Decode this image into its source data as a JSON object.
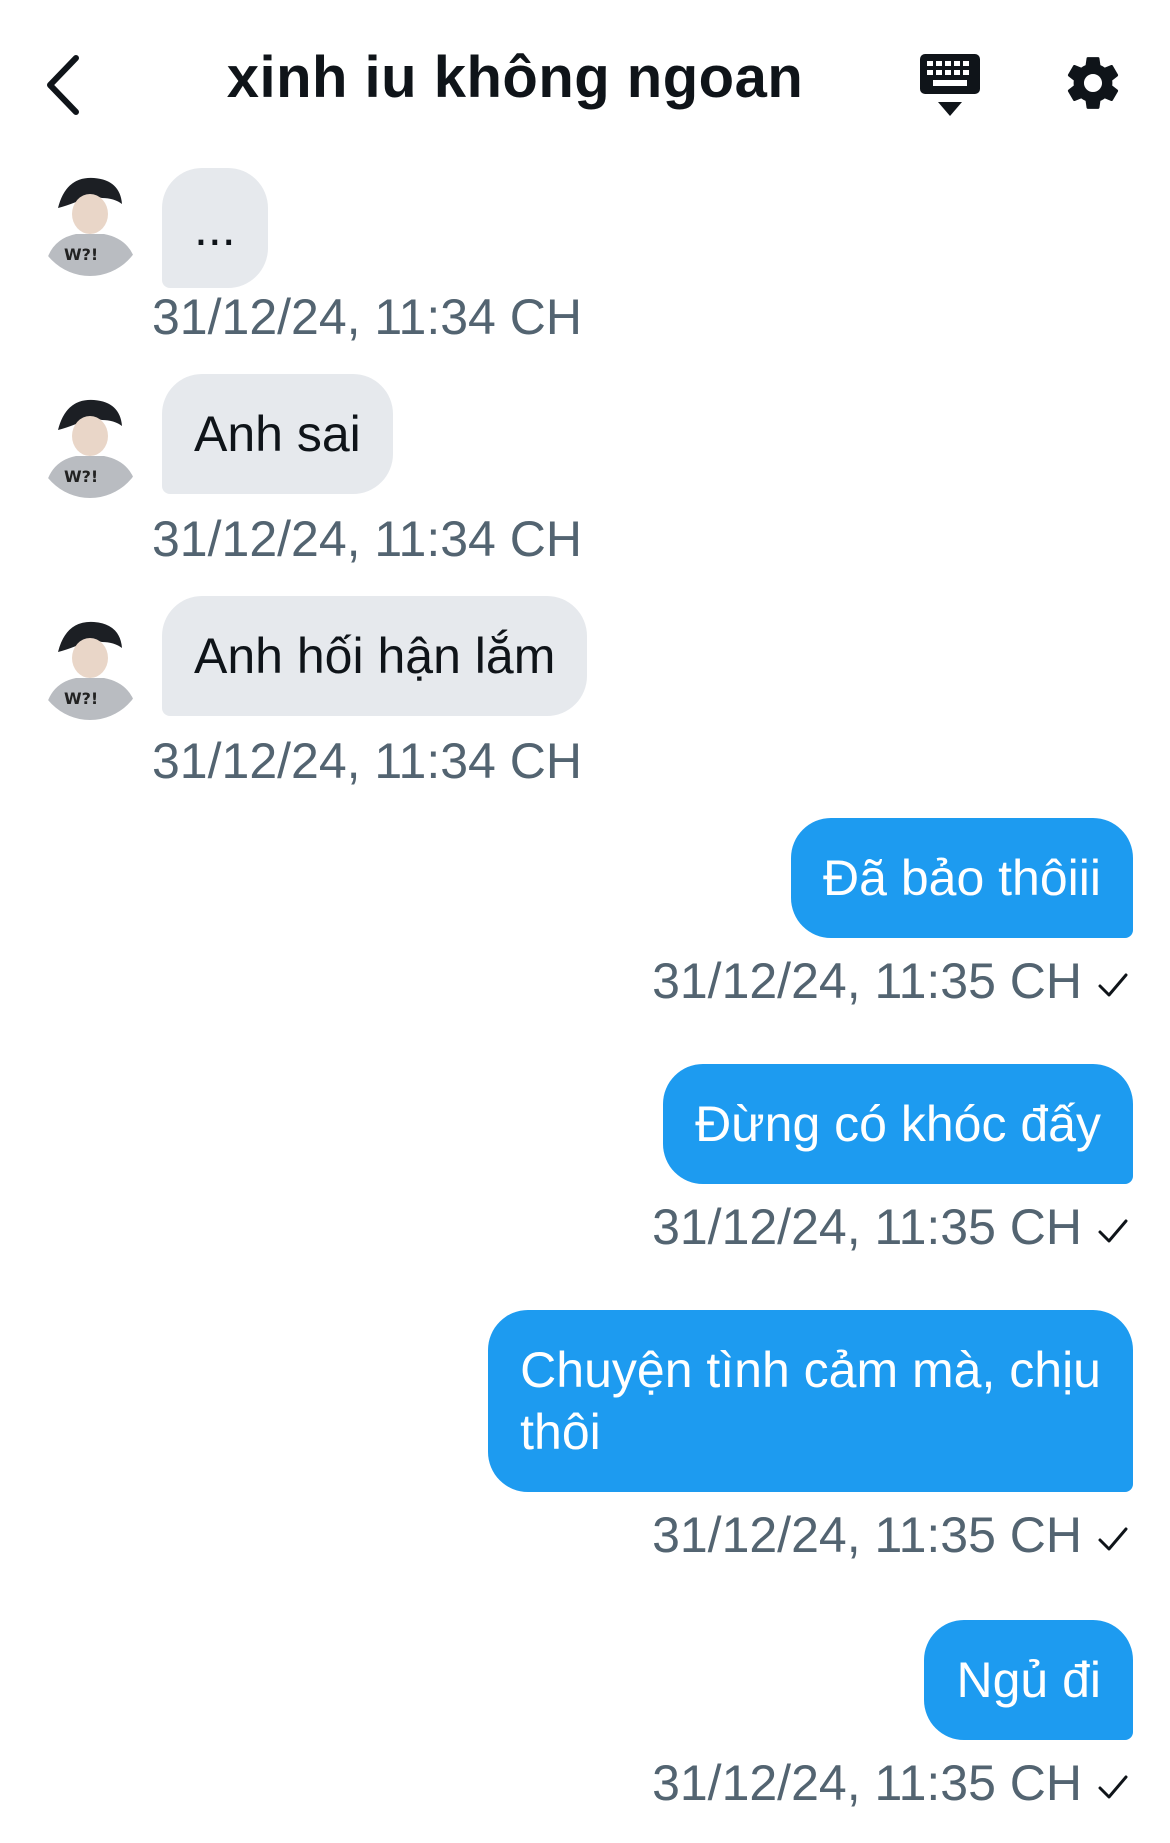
{
  "header": {
    "title": "xinh iu không ngoan",
    "back_icon": "chevron-left-icon",
    "keyboard_icon": "keyboard-icon",
    "settings_icon": "gear-icon"
  },
  "colors": {
    "incoming_bubble": "#e6e9ed",
    "outgoing_bubble": "#1d9bf0",
    "timestamp": "#536471",
    "text": "#0f1419"
  },
  "messages": [
    {
      "direction": "incoming",
      "text": "...",
      "time": "31/12/24, 11:34 CH"
    },
    {
      "direction": "incoming",
      "text": "Anh sai",
      "time": "31/12/24, 11:34 CH"
    },
    {
      "direction": "incoming",
      "text": "Anh hối hận lắm",
      "time": "31/12/24, 11:34 CH"
    },
    {
      "direction": "outgoing",
      "text": "Đã bảo thôiii",
      "time": "31/12/24, 11:35 CH",
      "status_icon": "checkmark-icon"
    },
    {
      "direction": "outgoing",
      "text": "Đừng có khóc đấy",
      "time": "31/12/24, 11:35 CH",
      "status_icon": "checkmark-icon"
    },
    {
      "direction": "outgoing",
      "text": "Chuyện tình cảm mà, chịu\nthôi",
      "time": "31/12/24, 11:35 CH",
      "status_icon": "checkmark-icon"
    },
    {
      "direction": "outgoing",
      "text": "Ngủ đi",
      "time": "31/12/24, 11:35 CH",
      "status_icon": "checkmark-icon"
    }
  ]
}
